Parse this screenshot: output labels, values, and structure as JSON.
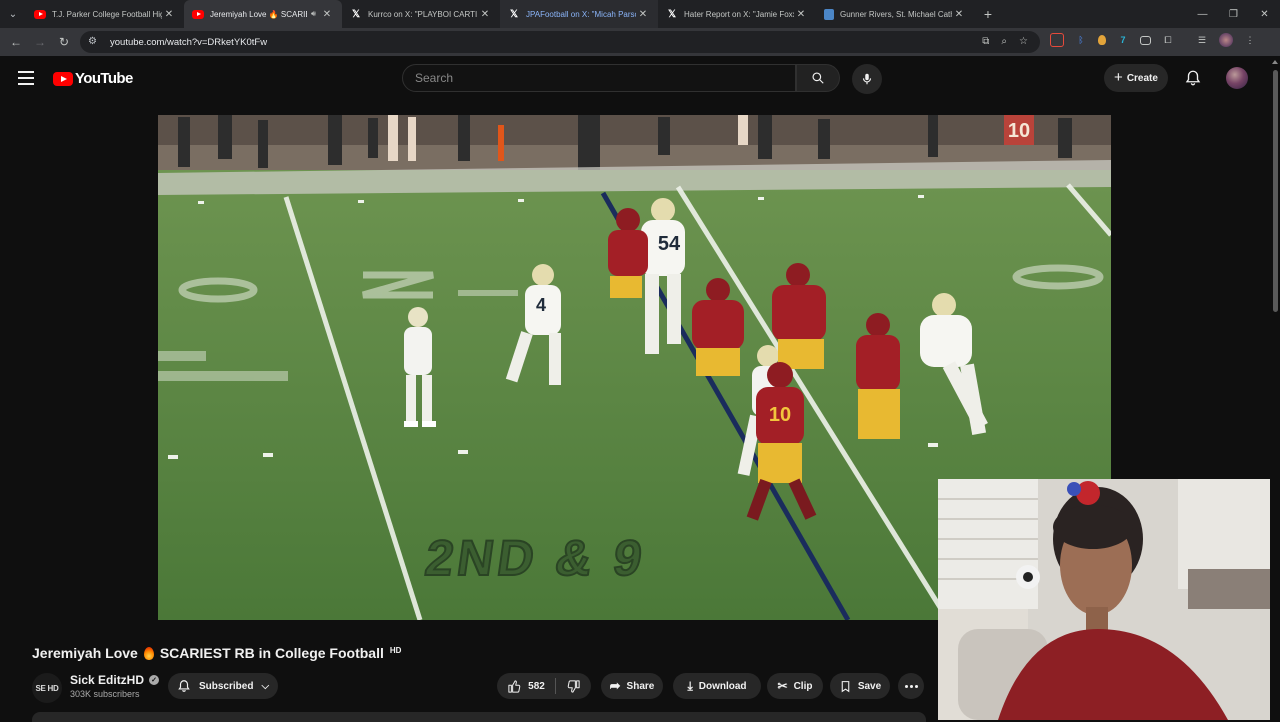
{
  "browser": {
    "tabs": [
      {
        "title": "T.J. Parker College Football Hig",
        "icon": "youtube-icon",
        "active": false
      },
      {
        "title": "Jeremiyah Love 🔥 SCARIEST",
        "icon": "youtube-icon",
        "active": true,
        "audio": true
      },
      {
        "title": "Kurrco on X: \"PLAYBOI CARTI D",
        "icon": "x-icon",
        "active": false
      },
      {
        "title": "JPAFootball on X: \"Micah Parso",
        "icon": "x-icon",
        "active": false,
        "hover": true
      },
      {
        "title": "Hater Report on X: \"Jamie Foxx",
        "icon": "x-icon",
        "active": false
      },
      {
        "title": "Gunner Rivers, St. Michael Cath",
        "icon": "document-icon",
        "active": false
      }
    ],
    "url": "youtube.com/watch?v=DRketYK0tFw"
  },
  "youtube": {
    "logo_text": "YouTube",
    "search_placeholder": "Search",
    "create_label": "Create"
  },
  "video": {
    "title_before_emoji": "Jeremiyah Love",
    "title_after_emoji": "SCARIEST RB in College Football",
    "quality_badge": "HD",
    "scoreboard_number": "10",
    "field_graphic": "2ND & 9",
    "jersey_numbers": [
      "54",
      "4",
      "10"
    ]
  },
  "channel": {
    "avatar_text": "SE HD",
    "name": "Sick EditzHD",
    "subscribers": "303K subscribers",
    "subscribe_label": "Subscribed"
  },
  "actions": {
    "likes": "582",
    "share_label": "Share",
    "download_label": "Download",
    "clip_label": "Clip",
    "save_label": "Save"
  },
  "colors": {
    "youtube_red": "#ff0000",
    "page_bg": "#0f0f0f",
    "button_bg": "#272727",
    "field_green": "#4d7a3a",
    "usc_cardinal": "#9e1b20",
    "usc_gold": "#ffc72c"
  }
}
